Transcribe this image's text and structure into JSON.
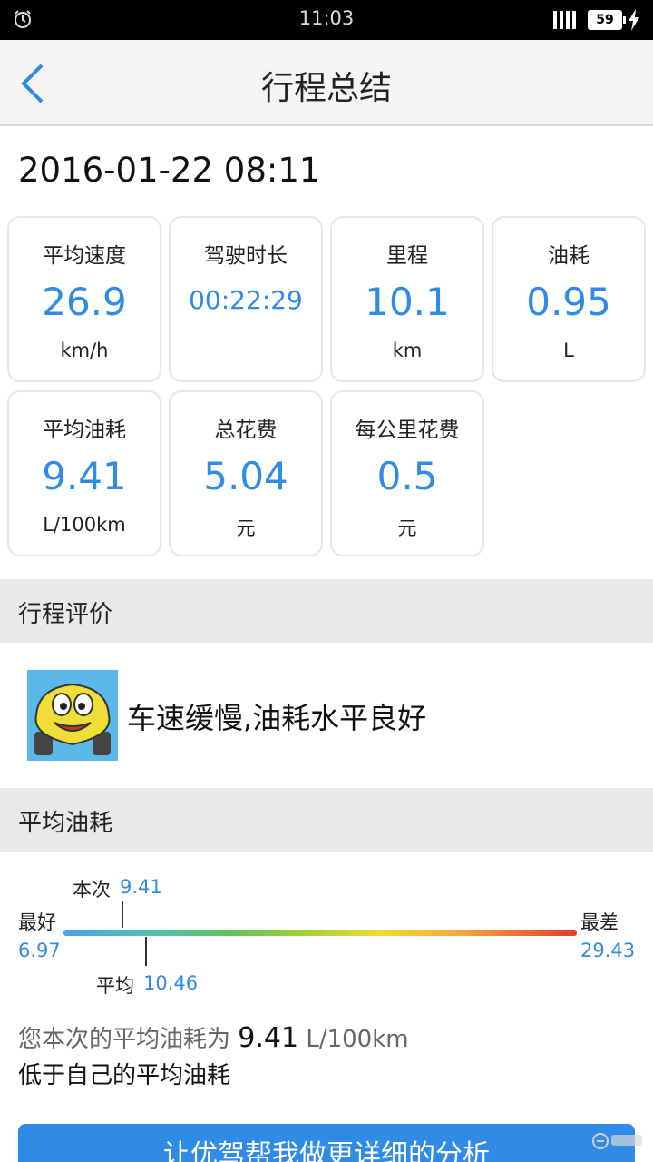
{
  "status_bar": {
    "time": "11:03",
    "battery": "59"
  },
  "nav": {
    "title": "行程总结"
  },
  "trip_date": "2016-01-22 08:11",
  "stats": [
    {
      "label": "平均速度",
      "value": "26.9",
      "unit": "km/h"
    },
    {
      "label": "驾驶时长",
      "value": "00:22:29",
      "unit": ""
    },
    {
      "label": "里程",
      "value": "10.1",
      "unit": "km"
    },
    {
      "label": "油耗",
      "value": "0.95",
      "unit": "L"
    },
    {
      "label": "平均油耗",
      "value": "9.41",
      "unit": "L/100km"
    },
    {
      "label": "总花费",
      "value": "5.04",
      "unit": "元"
    },
    {
      "label": "每公里花费",
      "value": "0.5",
      "unit": "元"
    }
  ],
  "evaluation": {
    "header": "行程评价",
    "text": "车速缓慢,油耗水平良好"
  },
  "fuel": {
    "header": "平均油耗",
    "current_label": "本次",
    "current_value": "9.41",
    "best_label": "最好",
    "best_value": "6.97",
    "worst_label": "最差",
    "worst_value": "29.43",
    "avg_label": "平均",
    "avg_value": "10.46",
    "summary_prefix": "您本次的平均油耗为",
    "summary_value": "9.41",
    "summary_unit": "L/100km",
    "summary_line2": "低于自己的平均油耗"
  },
  "button": {
    "label": "让优驾帮我做更详细的分析"
  },
  "colors": {
    "accent": "#2f8be6",
    "section_bg": "#e8e9ea"
  },
  "icons": {
    "back": "chevron-left-icon",
    "alarm": "alarm-icon",
    "avatar": "cartoon-car-icon"
  }
}
